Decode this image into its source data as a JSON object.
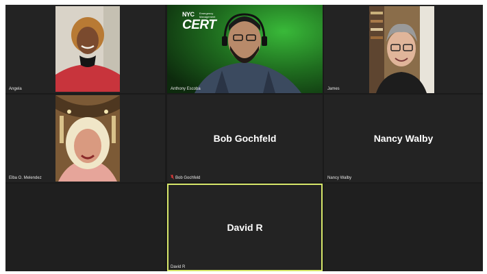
{
  "meeting": {
    "participants": [
      {
        "name": "Angela",
        "has_video": true
      },
      {
        "name": "Anthony Escoba",
        "has_video": true
      },
      {
        "name": "James",
        "has_video": true
      },
      {
        "name": "Elba O. Melendez",
        "has_video": true
      },
      {
        "name": "Bob Gochfeld",
        "display": "Bob Gochfeld",
        "has_video": false,
        "muted": true
      },
      {
        "name": "Nancy Walby",
        "display": "Nancy Walby",
        "has_video": false,
        "muted": false
      },
      {
        "name": "David R",
        "display": "David R",
        "has_video": false,
        "active_speaker": true
      }
    ],
    "background_logo": {
      "brand": "NYC",
      "subtitle_line1": "Emergency",
      "subtitle_line2": "Management",
      "title": "CERT"
    },
    "colors": {
      "tile_background": "#232323",
      "grid_background": "#1a1a1a",
      "active_speaker_border": "#d7e86a",
      "muted_icon": "#e03a3a",
      "green_backdrop": "#2e8a2e"
    },
    "icons": {
      "mute": "mic-muted-icon"
    }
  }
}
